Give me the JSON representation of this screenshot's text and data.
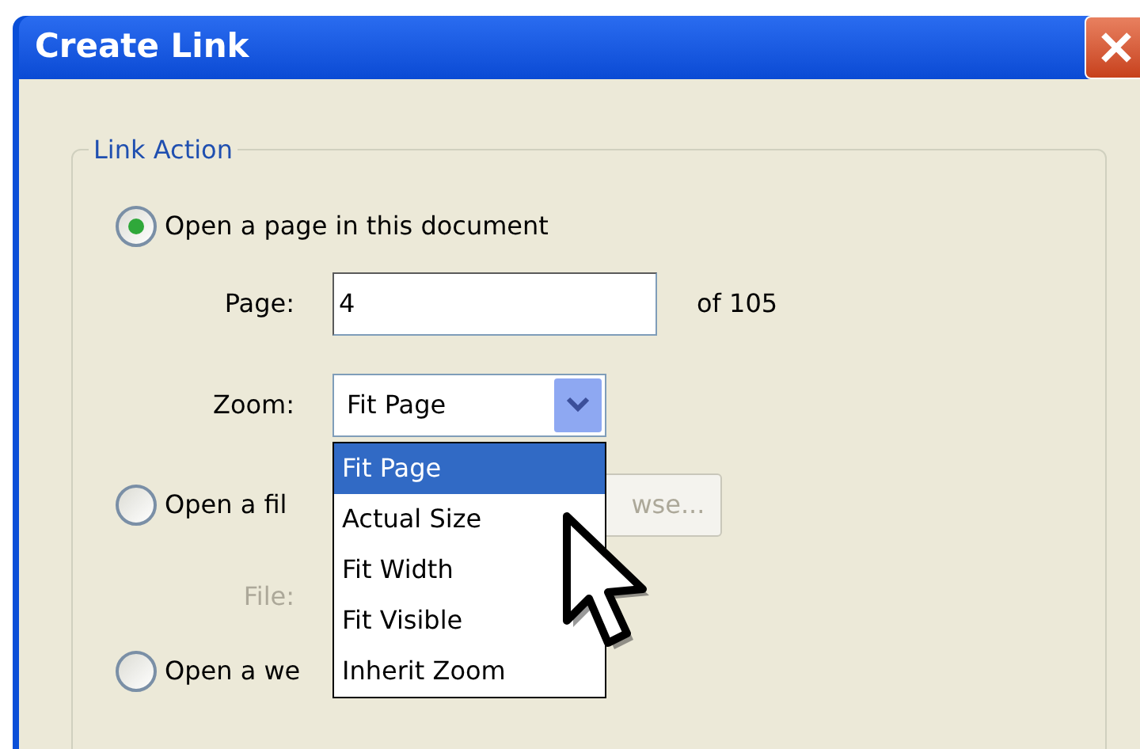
{
  "window": {
    "title": "Create Link"
  },
  "group": {
    "label": "Link Action"
  },
  "options": [
    {
      "label": "Open a page in this document",
      "selected": true
    },
    {
      "label": "Open a fil",
      "selected": false
    },
    {
      "label": "Open a we",
      "selected": false
    }
  ],
  "page": {
    "label": "Page:",
    "value": "4",
    "total": "of 105"
  },
  "zoom": {
    "label": "Zoom:",
    "value": "Fit Page",
    "expanded": true,
    "options": [
      {
        "label": "Fit Page",
        "selected": true
      },
      {
        "label": "Actual Size",
        "selected": false
      },
      {
        "label": "Fit Width",
        "selected": false
      },
      {
        "label": "Fit Visible",
        "selected": false
      },
      {
        "label": "Inherit Zoom",
        "selected": false
      }
    ]
  },
  "file": {
    "label": "File:",
    "disabled": true,
    "browse": "wse..."
  }
}
